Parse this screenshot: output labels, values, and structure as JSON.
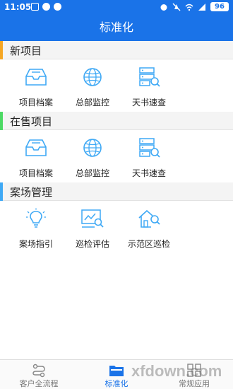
{
  "status_bar": {
    "time": "11:05",
    "battery": "96"
  },
  "header": {
    "title": "标准化"
  },
  "sections": [
    {
      "title": "新项目",
      "accent": "#f5a623",
      "items": [
        {
          "label": "项目档案",
          "icon": "inbox-tray-icon"
        },
        {
          "label": "总部监控",
          "icon": "globe-icon"
        },
        {
          "label": "天书速查",
          "icon": "server-search-icon"
        }
      ]
    },
    {
      "title": "在售项目",
      "accent": "#4cd964",
      "items": [
        {
          "label": "项目档案",
          "icon": "inbox-tray-icon"
        },
        {
          "label": "总部监控",
          "icon": "globe-icon"
        },
        {
          "label": "天书速查",
          "icon": "server-search-icon"
        }
      ]
    },
    {
      "title": "案场管理",
      "accent": "#3fa9f5",
      "items": [
        {
          "label": "案场指引",
          "icon": "lightbulb-icon"
        },
        {
          "label": "巡检评估",
          "icon": "chart-search-icon"
        },
        {
          "label": "示范区巡检",
          "icon": "house-search-icon"
        }
      ]
    }
  ],
  "bottom_nav": {
    "items": [
      {
        "label": "客户全流程",
        "icon": "flow-icon",
        "active": false
      },
      {
        "label": "标准化",
        "icon": "folder-icon",
        "active": true
      },
      {
        "label": "常规应用",
        "icon": "grid-icon",
        "active": false
      }
    ]
  },
  "watermark": "xfdown.com",
  "colors": {
    "primary": "#1a73e8",
    "icon_blue": "#3fa9f5"
  }
}
